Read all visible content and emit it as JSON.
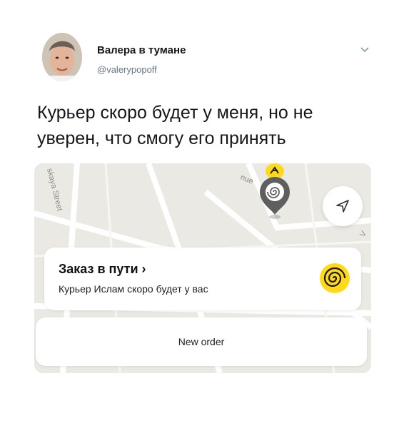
{
  "tweet": {
    "author_name": "Валера в тумане",
    "author_handle": "@valerypopoff",
    "text_line1": "Курьер скоро будет у меня, но не",
    "text_line2": "уверен, что смогу его принять"
  },
  "app": {
    "map_labels": {
      "street_left": "skaya Street",
      "street_top": "nue",
      "street_right": "V"
    },
    "order_card": {
      "title": "Заказ в пути",
      "title_chevron": "›",
      "subtitle": "Курьер Ислам скоро будет у вас"
    },
    "new_order_button": "New order"
  },
  "colors": {
    "accent_yellow": "#ffd91a",
    "handle_gray": "#657786",
    "map_bg": "#eceae4"
  }
}
